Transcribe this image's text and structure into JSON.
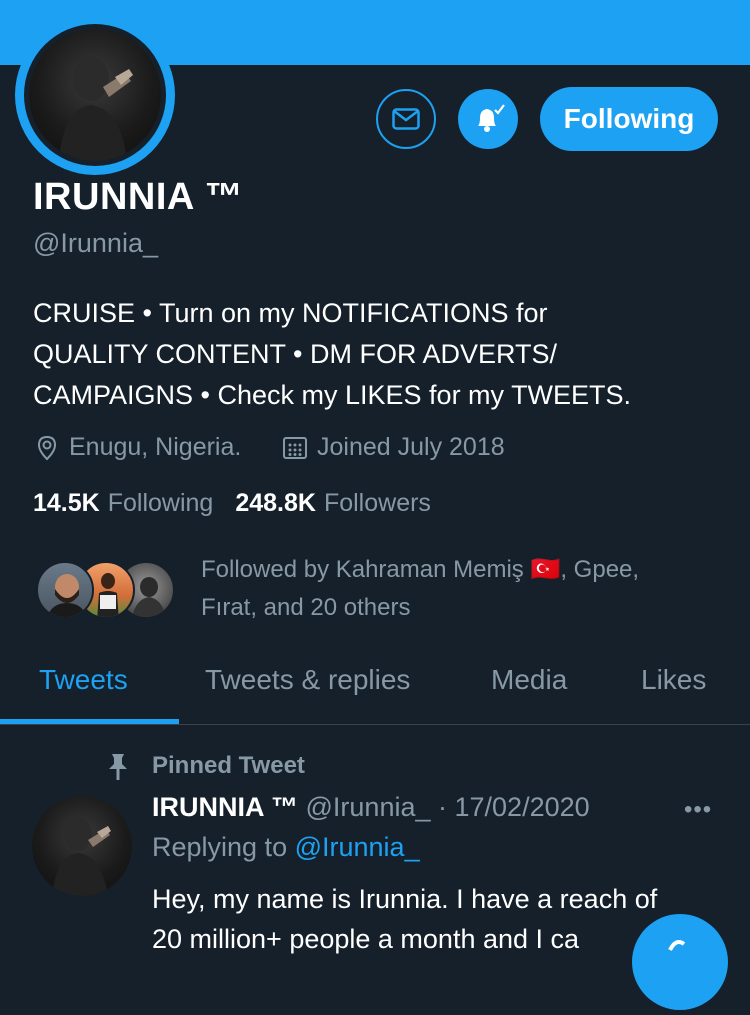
{
  "colors": {
    "background": "#15202b",
    "accent": "#1da1f2",
    "secondary_text": "#8899a6"
  },
  "header": {
    "message_icon": "envelope-icon",
    "notification_icon": "bell-check-icon",
    "follow_button_label": "Following"
  },
  "profile": {
    "name": "IRUNNIA ™",
    "handle": "@Irunnia_",
    "bio_line1": "CRUISE • Turn on my NOTIFICATIONS for",
    "bio_line2": "QUALITY CONTENT • DM FOR ADVERTS/",
    "bio_line3": "CAMPAIGNS • Check my LIKES for my TWEETS.",
    "location": "Enugu, Nigeria.",
    "joined": "Joined July 2018",
    "following_count": "14.5K",
    "following_label": "Following",
    "followers_count": "248.8K",
    "followers_label": "Followers",
    "followed_by_line1": "Followed by Kahraman Memiş 🇹🇷, Gpee,",
    "followed_by_line2": "Fırat, and 20 others"
  },
  "tabs": [
    {
      "label": "Tweets",
      "active": true
    },
    {
      "label": "Tweets & replies",
      "active": false
    },
    {
      "label": "Media",
      "active": false
    },
    {
      "label": "Likes",
      "active": false
    }
  ],
  "pinned_tweet": {
    "pinned_label": "Pinned Tweet",
    "author_name": "IRUNNIA ™",
    "author_handle": "@Irunnia_",
    "date": "· 17/02/2020",
    "more_label": "•••",
    "replying_prefix": "Replying to",
    "replying_handle": "@Irunnia_",
    "text_line1": "Hey, my name is Irunnia. I have a reach of",
    "text_line2": "20 million+ people a month and I ca"
  }
}
